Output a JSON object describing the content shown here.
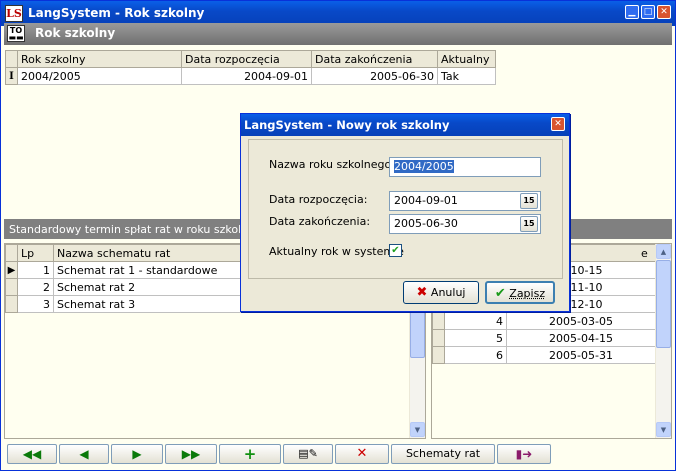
{
  "window": {
    "title": "LangSystem - Rok szkolny",
    "icon": "LS-app-icon"
  },
  "section": {
    "title": "Rok szkolny",
    "icon_text": "TO"
  },
  "year_table": {
    "columns": [
      "Rok szkolny",
      "Data rozpoczęcia",
      "Data zakończenia",
      "Aktualny"
    ],
    "rows": [
      [
        "2004/2005",
        "2004-09-01",
        "2005-06-30",
        "Tak"
      ]
    ],
    "row_indicator": "I"
  },
  "lower": {
    "caption": "Standardowy termin spłat rat w roku szkolnym",
    "left_table": {
      "columns": [
        "Lp",
        "Nazwa schematu rat"
      ],
      "rows": [
        [
          "1",
          "Schemat rat 1 - standardowe"
        ],
        [
          "2",
          "Schemat rat 2"
        ],
        [
          "3",
          "Schemat rat 3"
        ]
      ],
      "row_indicator": "▶"
    },
    "right_table": {
      "header_tail": "e",
      "rows": [
        [
          "",
          "4-10-15"
        ],
        [
          "",
          "4-11-10"
        ],
        [
          "",
          "4-12-10"
        ],
        [
          "4",
          "2005-03-05"
        ],
        [
          "5",
          "2005-04-15"
        ],
        [
          "6",
          "2005-05-31"
        ]
      ]
    }
  },
  "toolbar": {
    "first": "first-icon",
    "prev": "prev-icon",
    "next": "next-icon",
    "last": "last-icon",
    "add": "add-icon",
    "edit": "edit-icon",
    "delete": "delete-icon",
    "schemes_label": "Schematy rat",
    "exit": "exit-icon"
  },
  "dialog": {
    "title": "LangSystem - Nowy rok szkolny",
    "name_label": "Nazwa roku szkolnego:",
    "name_value": "2004/2005",
    "start_label": "Data rozpoczęcia:",
    "start_value": "2004-09-01",
    "end_label": "Data zakończenia:",
    "end_value": "2005-06-30",
    "current_label": "Aktualny rok w systemie",
    "current_checked": true,
    "cal_text": "15",
    "cancel_label": "Anuluj",
    "save_label": "Zapisz"
  }
}
